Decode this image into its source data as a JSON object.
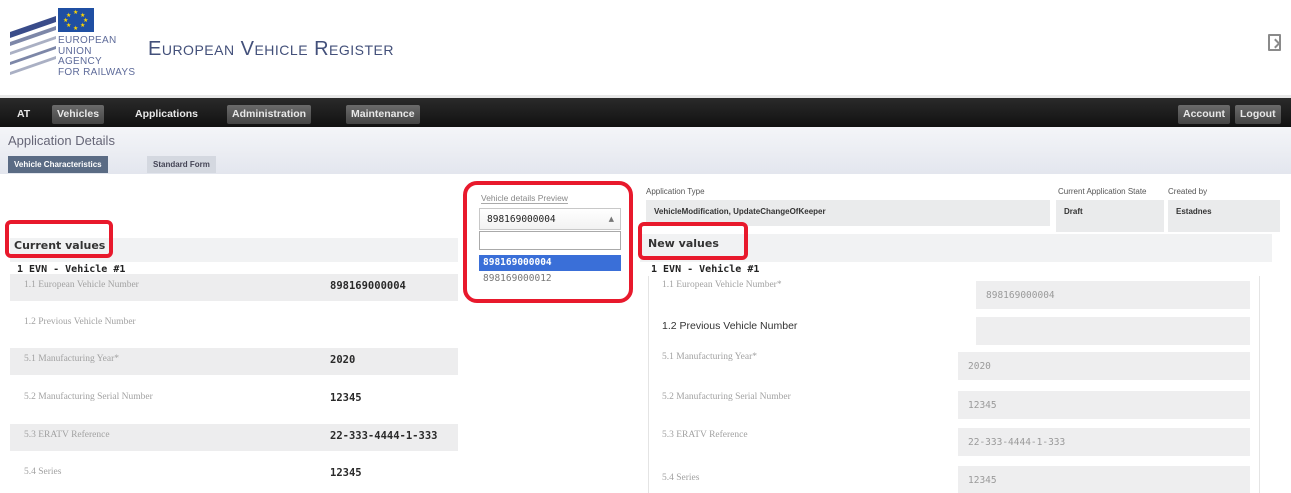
{
  "header": {
    "agency_lines": [
      "EUROPEAN",
      "UNION",
      "AGENCY",
      "FOR RAILWAYS"
    ],
    "app_title": "European Vehicle Register",
    "exit_icon": "exit-icon"
  },
  "nav": {
    "items": [
      "AT",
      "Vehicles",
      "Applications",
      "Administration",
      "Maintenance"
    ],
    "right_items": [
      "Account",
      "Logout"
    ]
  },
  "page": {
    "heading": "Application Details",
    "tabs": [
      "Vehicle Characteristics",
      "Standard Form"
    ]
  },
  "application": {
    "type_label": "Application Type",
    "type_value": "VehicleModification, UpdateChangeOfKeeper",
    "state_label": "Current Application State",
    "state_value": "Draft",
    "created_by_label": "Created by",
    "created_by_value": "Estadnes"
  },
  "preview": {
    "label": "Vehicle details Preview",
    "selected": "898169000004",
    "options": [
      "898169000004",
      "898169000012"
    ]
  },
  "current": {
    "title": "Current values",
    "group": "1 EVN - Vehicle #1",
    "rows": [
      {
        "label": "1.1 European Vehicle Number",
        "value": "898169000004"
      },
      {
        "label": "1.2 Previous Vehicle Number",
        "value": ""
      },
      {
        "label": "5.1 Manufacturing Year*",
        "value": "2020"
      },
      {
        "label": "5.2 Manufacturing Serial Number",
        "value": "12345"
      },
      {
        "label": "5.3 ERATV Reference",
        "value": "22-333-4444-1-333"
      },
      {
        "label": "5.4 Series",
        "value": "12345"
      }
    ]
  },
  "new": {
    "title": "New values",
    "group": "1 EVN - Vehicle #1",
    "rows": [
      {
        "label": "1.1 European Vehicle Number*",
        "value": "898169000004"
      },
      {
        "label": "1.2 Previous Vehicle Number",
        "value": ""
      },
      {
        "label": "5.1 Manufacturing Year*",
        "value": "2020"
      },
      {
        "label": "5.2 Manufacturing Serial Number",
        "value": "12345"
      },
      {
        "label": "5.3 ERATV Reference",
        "value": "22-333-4444-1-333"
      },
      {
        "label": "5.4 Series",
        "value": "12345"
      }
    ]
  },
  "colors": {
    "highlight": "#e8192c",
    "nav_bg": "#1a1a1a",
    "tab_active": "#5a6b84",
    "selected_option": "#3a6fd8"
  }
}
